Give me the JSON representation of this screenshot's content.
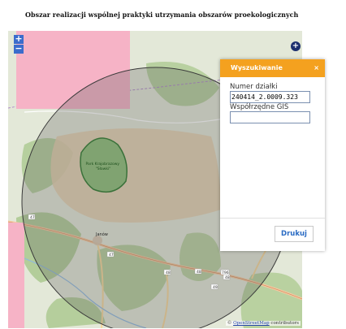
{
  "page": {
    "title": "Obszar realizacji wspólnej praktyki utrzymania obszarów proekologicznych"
  },
  "map": {
    "zoom_in": "+",
    "zoom_out": "−",
    "layer_switcher": "+",
    "labels": {
      "park": "Park Krajobrazowy\n\"Sławki\"",
      "town": "Janów",
      "road_47": "47",
      "road_47b": "47",
      "road_48": "48",
      "road_48b": "48",
      "road_48c": "48",
      "road_49": "49",
      "road_796": "796"
    },
    "attribution_prefix": "© ",
    "attribution_link": "OpenStreetMap",
    "attribution_suffix": " contributors"
  },
  "search_panel": {
    "title": "Wyszukiwanie",
    "close": "×",
    "parcel_label": "Numer działki",
    "parcel_value": "240414_2.0009.323",
    "gis_label": "Współrzędne GIS",
    "gis_value": "",
    "print_label": "Drukuj"
  },
  "colors": {
    "accent": "#f4a11f",
    "zoom": "#3b6ccc",
    "pink": "#f6b3c6"
  }
}
